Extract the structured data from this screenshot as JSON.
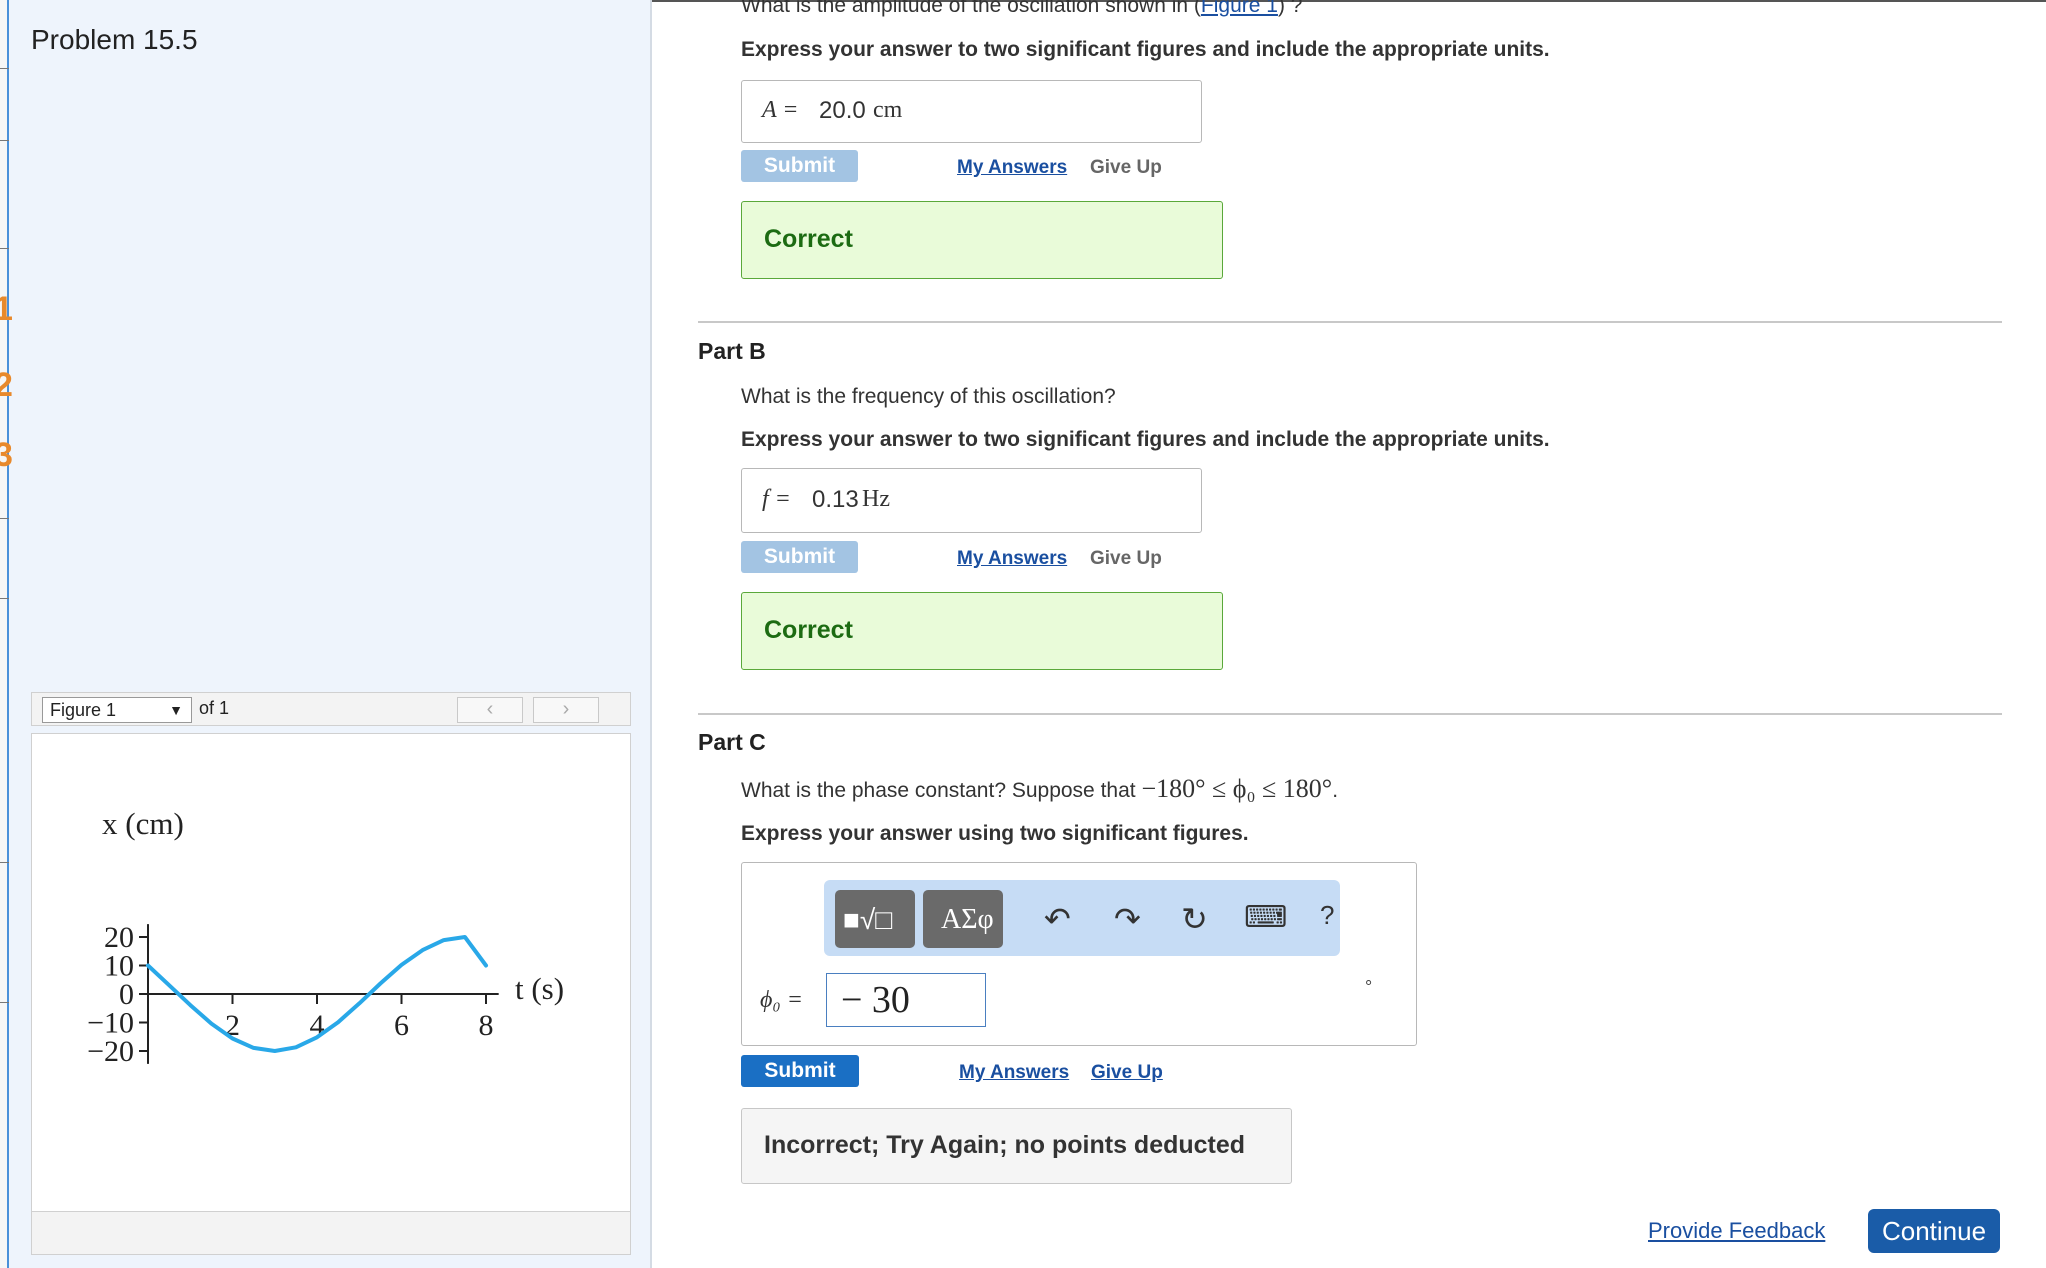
{
  "problem_title": "Problem 15.5",
  "figure_viewer": {
    "select_label": "Figure 1",
    "select_arrow": "▼",
    "of_label": "of 1",
    "prev_icon": "‹",
    "next_icon": "›"
  },
  "chart_data": {
    "type": "line",
    "ylabel": "x (cm)",
    "xlabel": "t (s)",
    "xlim": [
      0,
      8
    ],
    "ylim": [
      -20,
      20
    ],
    "x_ticks": [
      "2",
      "4",
      "6",
      "8"
    ],
    "y_ticks": [
      "20",
      "10",
      "0",
      "−10",
      "−20"
    ],
    "series": [
      {
        "x": [
          0,
          0.5,
          1,
          1.5,
          2,
          2.5,
          3,
          3.5,
          4,
          4.5,
          5,
          5.5,
          6,
          6.5,
          7,
          7.5,
          8
        ],
        "y": [
          10,
          3.1,
          -3.9,
          -10.4,
          -15.6,
          -18.9,
          -20.0,
          -18.7,
          -15.2,
          -9.9,
          -3.3,
          3.7,
          10.2,
          15.4,
          18.9,
          20.0,
          10.0
        ]
      }
    ],
    "color": "#29a8e8"
  },
  "part_a": {
    "question_prefix": "What is the amplitude of the oscillation shown in (",
    "figure_link": "Figure 1",
    "question_suffix": ") ?",
    "instruction": "Express your answer to two significant figures and include the appropriate units.",
    "var_label": "A =",
    "answer_number": "20.0",
    "answer_unit": "cm",
    "submit_label": "Submit",
    "my_answers_label": "My Answers",
    "give_up_label": "Give Up",
    "feedback": "Correct"
  },
  "part_b": {
    "title": "Part B",
    "question": "What is the frequency of this oscillation?",
    "instruction": "Express your answer to two significant figures and include the appropriate units.",
    "var_label": "f =",
    "answer_number": "0.13",
    "answer_unit": "Hz",
    "submit_label": "Submit",
    "my_answers_label": "My Answers",
    "give_up_label": "Give Up",
    "feedback": "Correct"
  },
  "part_c": {
    "title": "Part C",
    "question_prefix": "What is the phase constant? Suppose that ",
    "question_math": "−180° ≤ ϕ₀ ≤ 180°",
    "question_suffix": ".",
    "instruction": "Express your answer using two significant figures.",
    "toolbar": {
      "templates_icon": "■√□",
      "symbols_label": "ΑΣφ",
      "undo_icon": "↶",
      "redo_icon": "↷",
      "reset_icon": "↻",
      "keyboard_icon": "⌨",
      "help_icon": "?"
    },
    "var_label": "ϕ₀ =",
    "answer_value": "− 30",
    "unit_symbol": "°",
    "submit_label": "Submit",
    "my_answers_label": "My Answers",
    "give_up_label": "Give Up",
    "feedback": "Incorrect; Try Again; no points deducted"
  },
  "footer": {
    "provide_feedback": "Provide Feedback",
    "continue": "Continue"
  },
  "edge_numbers": [
    "1",
    "2",
    "3"
  ]
}
